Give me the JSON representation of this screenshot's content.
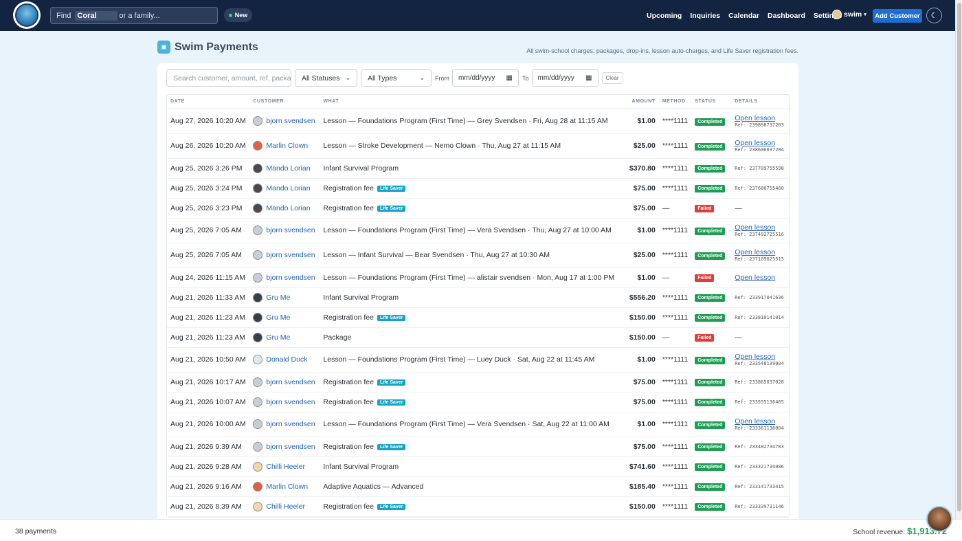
{
  "topnav": {
    "find_prefix": "Find",
    "find_term": "Coral",
    "find_suffix": "or a family...",
    "new_label": "New",
    "links": [
      "Upcoming",
      "Inquiries",
      "Calendar",
      "Dashboard",
      "Settings"
    ],
    "user_label": "swim",
    "add_customer_label": "Add Customer"
  },
  "header": {
    "title": "Swim Payments",
    "subtitle": "All swim-school charges: packages, drop-ins, lesson auto-charges, and Life Saver registration fees."
  },
  "filters": {
    "search_placeholder": "Search customer, amount, ref, package...",
    "status_value": "All Statuses",
    "type_value": "All Types",
    "from_label": "From",
    "to_label": "To",
    "date_placeholder": "mm/dd/yyyy",
    "clear_label": "Clear"
  },
  "table": {
    "headers": [
      "Date",
      "Customer",
      "What",
      "Amount",
      "Method",
      "Status",
      "Details"
    ],
    "rows": [
      {
        "date": "Aug 27, 2026 10:20 AM",
        "customer": "bjorn svendsen",
        "what": "Lesson — Foundations Program (First Time) — Grey Svendsen · Fri, Aug 28 at 11:15 AM",
        "badge": "",
        "amount": "$1.00",
        "method": "****1111",
        "status": "Completed",
        "link": "Open lesson",
        "ref": "Ref: 239898737203"
      },
      {
        "date": "Aug 26, 2026 10:20 AM",
        "customer": "Marlin Clown",
        "what": "Lesson — Stroke Development — Nemo Clown · Thu, Aug 27 at 11:15 AM",
        "badge": "",
        "amount": "$25.00",
        "method": "****1111",
        "status": "Completed",
        "link": "Open lesson",
        "ref": "Ref: 238606037204"
      },
      {
        "date": "Aug 25, 2026 3:26 PM",
        "customer": "Mando Lorian",
        "what": "Infant Survival Program",
        "badge": "",
        "amount": "$370.80",
        "method": "****1111",
        "status": "Completed",
        "link": "",
        "ref": "Ref: 237709755598"
      },
      {
        "date": "Aug 25, 2026 3:24 PM",
        "customer": "Mando Lorian",
        "what": "Registration fee",
        "badge": "Life Saver",
        "amount": "$75.00",
        "method": "****1111",
        "status": "Completed",
        "link": "",
        "ref": "Ref: 237680755460"
      },
      {
        "date": "Aug 25, 2026 3:23 PM",
        "customer": "Mando Lorian",
        "what": "Registration fee",
        "badge": "Life Saver",
        "amount": "$75.00",
        "method": "—",
        "status": "Failed",
        "link": "",
        "ref": "—"
      },
      {
        "date": "Aug 25, 2026 7:05 AM",
        "customer": "bjorn svendsen",
        "what": "Lesson — Foundations Program (First Time) — Vera Svendsen · Thu, Aug 27 at 10:00 AM",
        "badge": "",
        "amount": "$1.00",
        "method": "****1111",
        "status": "Completed",
        "link": "Open lesson",
        "ref": "Ref: 237492725516"
      },
      {
        "date": "Aug 25, 2026 7:05 AM",
        "customer": "bjorn svendsen",
        "what": "Lesson — Infant Survival — Bear Svendsen · Thu, Aug 27 at 10:30 AM",
        "badge": "",
        "amount": "$25.00",
        "method": "****1111",
        "status": "Completed",
        "link": "Open lesson",
        "ref": "Ref: 237109025515"
      },
      {
        "date": "Aug 24, 2026 11:15 AM",
        "customer": "bjorn svendsen",
        "what": "Lesson — Foundations Program (First Time) — alistair svendsen · Mon, Aug 17 at 1:00 PM",
        "badge": "",
        "amount": "$1.00",
        "method": "—",
        "status": "Failed",
        "link": "Open lesson",
        "ref": ""
      },
      {
        "date": "Aug 21, 2026 11:33 AM",
        "customer": "Gru Me",
        "what": "Infant Survival Program",
        "badge": "",
        "amount": "$556.20",
        "method": "****1111",
        "status": "Completed",
        "link": "",
        "ref": "Ref: 233917041636"
      },
      {
        "date": "Aug 21, 2026 11:23 AM",
        "customer": "Gru Me",
        "what": "Registration fee",
        "badge": "Life Saver",
        "amount": "$150.00",
        "method": "****1111",
        "status": "Completed",
        "link": "",
        "ref": "Ref: 233810141014"
      },
      {
        "date": "Aug 21, 2026 11:23 AM",
        "customer": "Gru Me",
        "what": "Package",
        "badge": "",
        "amount": "$150.00",
        "method": "—",
        "status": "Failed",
        "link": "",
        "ref": "—"
      },
      {
        "date": "Aug 21, 2026 10:50 AM",
        "customer": "Donald Duck",
        "what": "Lesson — Foundations Program (First Time) — Luey Duck · Sat, Aug 22 at 11:45 AM",
        "badge": "",
        "amount": "$1.00",
        "method": "****1111",
        "status": "Completed",
        "link": "Open lesson",
        "ref": "Ref: 233548139004"
      },
      {
        "date": "Aug 21, 2026 10:17 AM",
        "customer": "bjorn svendsen",
        "what": "Registration fee",
        "badge": "Life Saver",
        "amount": "$75.00",
        "method": "****1111",
        "status": "Completed",
        "link": "",
        "ref": "Ref: 233865037028"
      },
      {
        "date": "Aug 21, 2026 10:07 AM",
        "customer": "bjorn svendsen",
        "what": "Registration fee",
        "badge": "Life Saver",
        "amount": "$75.00",
        "method": "****1111",
        "status": "Completed",
        "link": "",
        "ref": "Ref: 233555136465"
      },
      {
        "date": "Aug 21, 2026 10:00 AM",
        "customer": "bjorn svendsen",
        "what": "Lesson — Foundations Program (First Time) — Vera Svendsen · Sat, Aug 22 at 11:00 AM",
        "badge": "",
        "amount": "$1.00",
        "method": "****1111",
        "status": "Completed",
        "link": "Open lesson",
        "ref": "Ref: 233361136004"
      },
      {
        "date": "Aug 21, 2026 9:39 AM",
        "customer": "bjorn svendsen",
        "what": "Registration fee",
        "badge": "Life Saver",
        "amount": "$75.00",
        "method": "****1111",
        "status": "Completed",
        "link": "",
        "ref": "Ref: 233482734783"
      },
      {
        "date": "Aug 21, 2026 9:28 AM",
        "customer": "Chilli Heeler",
        "what": "Infant Survival Program",
        "badge": "",
        "amount": "$741.60",
        "method": "****1111",
        "status": "Completed",
        "link": "",
        "ref": "Ref: 233321734086"
      },
      {
        "date": "Aug 21, 2026 9:16 AM",
        "customer": "Marlin Clown",
        "what": "Adaptive Aquatics — Advanced",
        "badge": "",
        "amount": "$185.40",
        "method": "****1111",
        "status": "Completed",
        "link": "",
        "ref": "Ref: 233141733415"
      },
      {
        "date": "Aug 21, 2026 8:39 AM",
        "customer": "Chilli Heeler",
        "what": "Registration fee",
        "badge": "Life Saver",
        "amount": "$150.00",
        "method": "****1111",
        "status": "Completed",
        "link": "",
        "ref": "Ref: 233339731146"
      }
    ]
  },
  "footer": {
    "count": "38 payments",
    "revenue_label": "School revenue:",
    "revenue_value": "$1,913.72"
  }
}
